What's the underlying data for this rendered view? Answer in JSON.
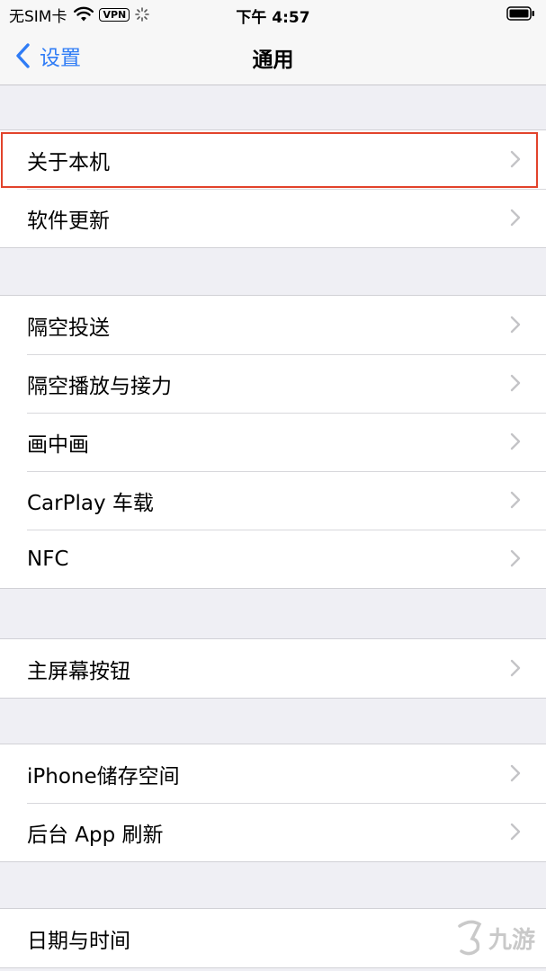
{
  "status_bar": {
    "carrier": "无SIM卡",
    "vpn": "VPN",
    "time": "下午 4:57"
  },
  "nav": {
    "back_label": "设置",
    "title": "通用"
  },
  "groups": [
    {
      "items": [
        {
          "label": "关于本机",
          "highlighted": true
        },
        {
          "label": "软件更新"
        }
      ]
    },
    {
      "items": [
        {
          "label": "隔空投送"
        },
        {
          "label": "隔空播放与接力"
        },
        {
          "label": "画中画"
        },
        {
          "label": "CarPlay 车载"
        },
        {
          "label": "NFC"
        }
      ]
    },
    {
      "items": [
        {
          "label": "主屏幕按钮"
        }
      ]
    },
    {
      "items": [
        {
          "label": "iPhone储存空间"
        },
        {
          "label": "后台 App 刷新"
        }
      ]
    },
    {
      "items": [
        {
          "label": "日期与时间"
        }
      ]
    }
  ],
  "watermark": "九游",
  "colors": {
    "accent": "#2f7cf6",
    "highlight": "#e2432b",
    "background": "#efeff4"
  }
}
